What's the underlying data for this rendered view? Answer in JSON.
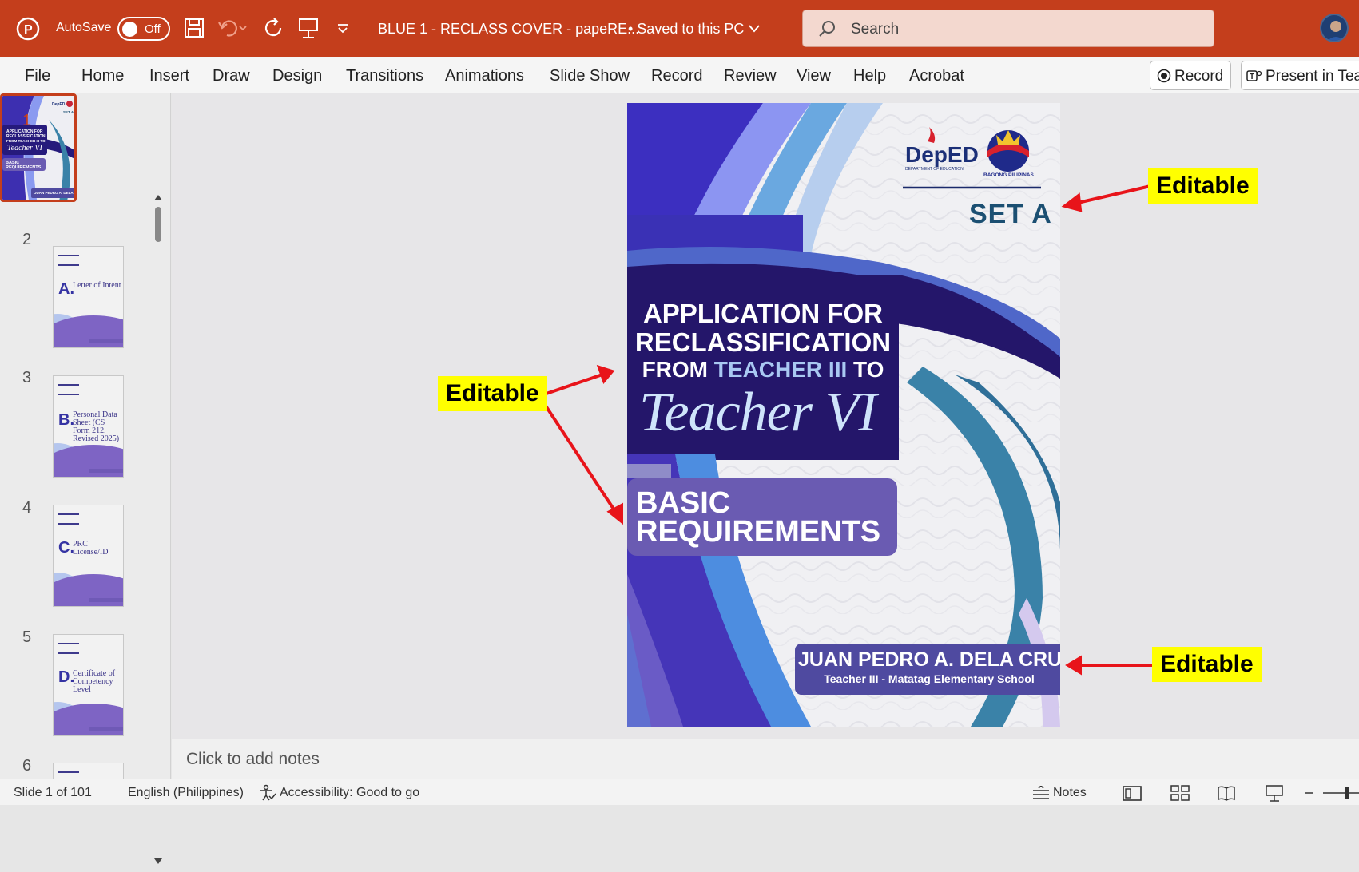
{
  "titlebar": {
    "autosave_label": "AutoSave",
    "autosave_state": "Off",
    "doc_title": "BLUE 1 - RECLASS COVER - papeRE...",
    "save_status": "• Saved to this PC",
    "search_placeholder": "Search"
  },
  "menu": {
    "items": [
      "File",
      "Home",
      "Insert",
      "Draw",
      "Design",
      "Transitions",
      "Animations",
      "Slide Show",
      "Record",
      "Review",
      "View",
      "Help",
      "Acrobat"
    ],
    "record_button": "Record",
    "present_button": "Present in Teams"
  },
  "slides": [
    {
      "num": "1"
    },
    {
      "num": "2",
      "letter": "A.",
      "label": "Letter of Intent"
    },
    {
      "num": "3",
      "letter": "B.",
      "label": "Personal Data Sheet (CS Form 212, Revised 2025)"
    },
    {
      "num": "4",
      "letter": "C.",
      "label": "PRC License/ID"
    },
    {
      "num": "5",
      "letter": "D.",
      "label": "Certificate of Competency Level"
    },
    {
      "num": "6"
    }
  ],
  "slide": {
    "deped_logo": "DepED",
    "deped_sub": "DEPARTMENT OF EDUCATION",
    "bagong_pilipinas": "BAGONG PILIPINAS",
    "set": "SET A",
    "title_line1": "APPLICATION FOR",
    "title_line2": "RECLASSIFICATION",
    "title_line3_a": "FROM ",
    "title_line3_b": "TEACHER III",
    "title_line3_c": " TO",
    "title_script": "Teacher VI",
    "basic_line1": "BASIC",
    "basic_line2": "REQUIREMENTS",
    "name": "JUAN PEDRO A. DELA CRUZ",
    "position": "Teacher III - Matatag Elementary School"
  },
  "callouts": {
    "top_right": "Editable",
    "left": "Editable",
    "bottom_right": "Editable"
  },
  "notes_placeholder": "Click to add notes",
  "status": {
    "slide_counter": "Slide 1 of 101",
    "language": "English (Philippines)",
    "accessibility": "Accessibility: Good to go",
    "notes": "Notes"
  },
  "colors": {
    "titlebar": "#c43e1c",
    "callout_bg": "#ffff00",
    "arrow": "#e8141a",
    "slide_navy": "#24166a",
    "slide_purple": "#6a5bb2"
  }
}
